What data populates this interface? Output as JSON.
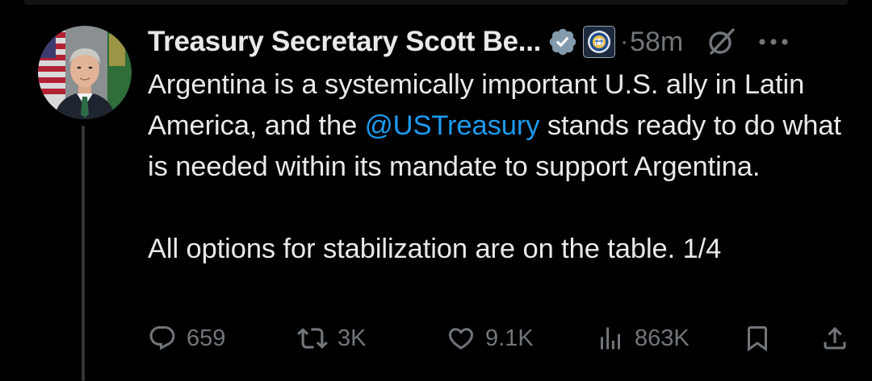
{
  "tweet": {
    "display_name": "Treasury Secretary Scott Be...",
    "separator": "·",
    "timestamp": "58m",
    "text_line_1": "Argentina is a systemically important U.S. ally in Latin America, and the ",
    "mention": "@USTreasury",
    "text_line_2": " stands ready to do what is needed within its mandate to support Argentina.",
    "text_paragraph_2": "All options for stabilization are on the table. 1/4"
  },
  "actions": {
    "replies": "659",
    "reposts": "3K",
    "likes": "9.1K",
    "views": "863K"
  },
  "colors": {
    "background": "#000000",
    "text": "#e7e9ea",
    "secondary": "#71767b",
    "link": "#1d9bf0",
    "thread_line": "#333639"
  },
  "icons": {
    "verified": "verified-badge-icon",
    "affiliation": "treasury-seal-icon",
    "grok": "grok-icon",
    "more": "more-icon",
    "reply": "reply-icon",
    "repost": "repost-icon",
    "like": "like-icon",
    "views": "views-icon",
    "bookmark": "bookmark-icon",
    "share": "share-icon"
  }
}
